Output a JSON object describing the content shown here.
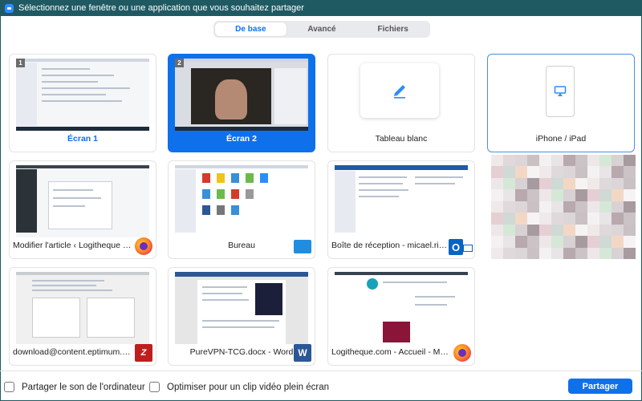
{
  "window": {
    "title": "Sélectionnez une fenêtre ou une application que vous souhaitez partager"
  },
  "tabs": [
    {
      "label": "De base",
      "active": true
    },
    {
      "label": "Avancé",
      "active": false
    },
    {
      "label": "Fichiers",
      "active": false
    }
  ],
  "sources": [
    {
      "label": "Écran 1",
      "badge": "1"
    },
    {
      "label": "Écran 2",
      "badge": "2",
      "selected": true
    },
    {
      "label": "Tableau blanc",
      "icon": "pencil-icon"
    },
    {
      "label": "iPhone / iPad",
      "icon": "airplay-icon"
    },
    {
      "label": "Modifier l'article ‹ Logitheque —...",
      "app_icon": "firefox-icon"
    },
    {
      "label": "Bureau",
      "app_icon": "desktop-icon"
    },
    {
      "label": "Boîte de réception - micael.ribeir...",
      "app_icon": "outlook-icon",
      "app_icon_text": "O"
    },
    {
      "label": "download@content.eptimum.co...",
      "app_icon": "filezilla-icon",
      "app_icon_text": "Z"
    },
    {
      "label": "PureVPN-TCG.docx - Word",
      "app_icon": "word-icon",
      "app_icon_text": "W"
    },
    {
      "label": "Logitheque.com - Accueil - Mozi...",
      "app_icon": "firefox-icon"
    }
  ],
  "footer": {
    "share_sound_label": "Partager le son de l'ordinateur",
    "optimize_video_label": "Optimiser pour un clip vidéo plein écran",
    "share_button": "Partager"
  },
  "colors": {
    "accent": "#0e71eb",
    "titlebar": "#1f5a63"
  }
}
